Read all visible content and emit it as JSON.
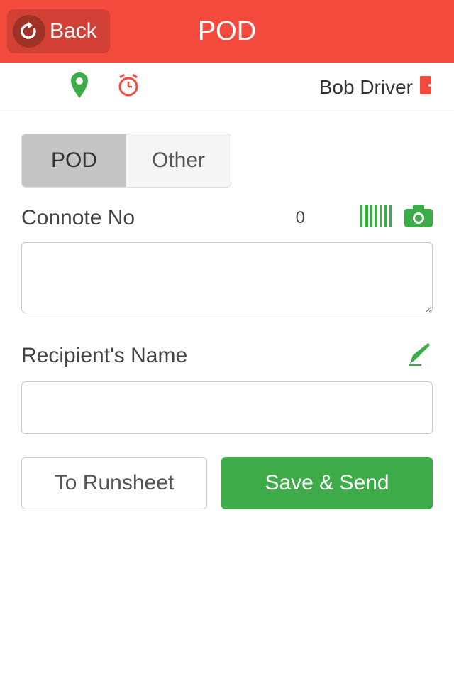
{
  "header": {
    "back_label": "Back",
    "title": "POD"
  },
  "subheader": {
    "username": "Bob Driver"
  },
  "tabs": {
    "pod": "POD",
    "other": "Other"
  },
  "form": {
    "connote_label": "Connote No",
    "connote_count": "0",
    "connote_value": "",
    "recipient_label": "Recipient's Name",
    "recipient_value": ""
  },
  "buttons": {
    "runsheet": "To Runsheet",
    "save": "Save & Send"
  }
}
